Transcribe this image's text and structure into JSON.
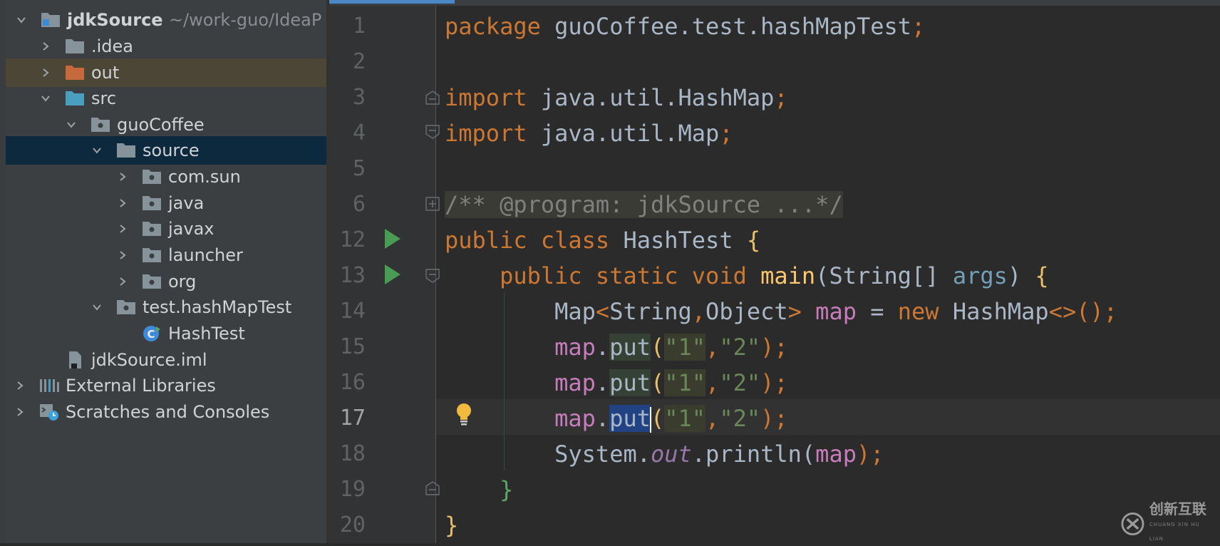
{
  "project_tree": {
    "root": {
      "name": "jdkSource",
      "path": "~/work-guo/IdeaP"
    },
    "items": [
      {
        "label": "jdkSource",
        "path": "~/work-guo/IdeaP",
        "icon": "module-folder-icon",
        "expanded": true
      },
      {
        "label": ".idea",
        "icon": "folder-icon",
        "expanded": false
      },
      {
        "label": "out",
        "icon": "excluded-folder-icon",
        "expanded": false
      },
      {
        "label": "src",
        "icon": "source-folder-icon",
        "expanded": true
      },
      {
        "label": "guoCoffee",
        "icon": "package-icon",
        "expanded": true
      },
      {
        "label": "source",
        "icon": "folder-icon",
        "expanded": true,
        "selected": true
      },
      {
        "label": "com.sun",
        "icon": "package-icon",
        "expanded": false
      },
      {
        "label": "java",
        "icon": "package-icon",
        "expanded": false
      },
      {
        "label": "javax",
        "icon": "package-icon",
        "expanded": false
      },
      {
        "label": "launcher",
        "icon": "package-icon",
        "expanded": false
      },
      {
        "label": "org",
        "icon": "package-icon",
        "expanded": false
      },
      {
        "label": "test.hashMapTest",
        "icon": "package-icon",
        "expanded": true
      },
      {
        "label": "HashTest",
        "icon": "java-class-icon"
      },
      {
        "label": "jdkSource.iml",
        "icon": "iml-file-icon"
      },
      {
        "label": "External Libraries",
        "icon": "libraries-icon",
        "expanded": false
      },
      {
        "label": "Scratches and Consoles",
        "icon": "scratches-icon",
        "expanded": false
      }
    ]
  },
  "editor": {
    "current_line": "17",
    "lines": [
      {
        "num": "1",
        "parts": [
          "package",
          " guoCoffee.test.hashMapTest",
          ";"
        ]
      },
      {
        "num": "2",
        "parts": []
      },
      {
        "num": "3",
        "parts": [
          "import",
          " java.util.HashMap",
          ";"
        ]
      },
      {
        "num": "4",
        "parts": [
          "import",
          " java.util.Map",
          ";"
        ]
      },
      {
        "num": "5",
        "parts": []
      },
      {
        "num": "6",
        "parts": [
          "/** @program: jdkSource ...*/"
        ]
      },
      {
        "num": "12",
        "parts": [
          "public class",
          " HashTest ",
          "{"
        ]
      },
      {
        "num": "13",
        "parts": [
          "public static void",
          " ",
          "main",
          "(String[] ",
          "args",
          ") ",
          "{"
        ]
      },
      {
        "num": "14",
        "parts": [
          "Map",
          "<",
          "String",
          ",",
          "Object",
          ">",
          " ",
          "map",
          " = ",
          "new",
          " HashMap",
          "<>",
          "();"
        ]
      },
      {
        "num": "15",
        "parts": [
          "map",
          ".",
          "put",
          "(",
          "\"1\"",
          ",",
          "\"2\"",
          ");"
        ]
      },
      {
        "num": "16",
        "parts": [
          "map",
          ".",
          "put",
          "(",
          "\"1\"",
          ",",
          "\"2\"",
          ");"
        ]
      },
      {
        "num": "17",
        "parts": [
          "map",
          ".",
          "put",
          "(",
          "\"1\"",
          ",",
          "\"2\"",
          ");"
        ]
      },
      {
        "num": "18",
        "parts": [
          "System.",
          "out",
          ".println(",
          "map",
          ");"
        ]
      },
      {
        "num": "19",
        "parts": [
          "}"
        ]
      },
      {
        "num": "20",
        "parts": [
          "}"
        ]
      }
    ]
  },
  "colors": {
    "keyword": "#cc7832",
    "string": "#6a8759",
    "method": "#ffc66d",
    "static_field": "#9876aa",
    "comment": "#808080",
    "local_var": "#c77dbb",
    "param": "#72a0b6",
    "run_icon": "#499c54",
    "selection": "#214283"
  },
  "watermark": {
    "text": "创新互联",
    "sub": "CHUANG XIN HU LIAN"
  }
}
